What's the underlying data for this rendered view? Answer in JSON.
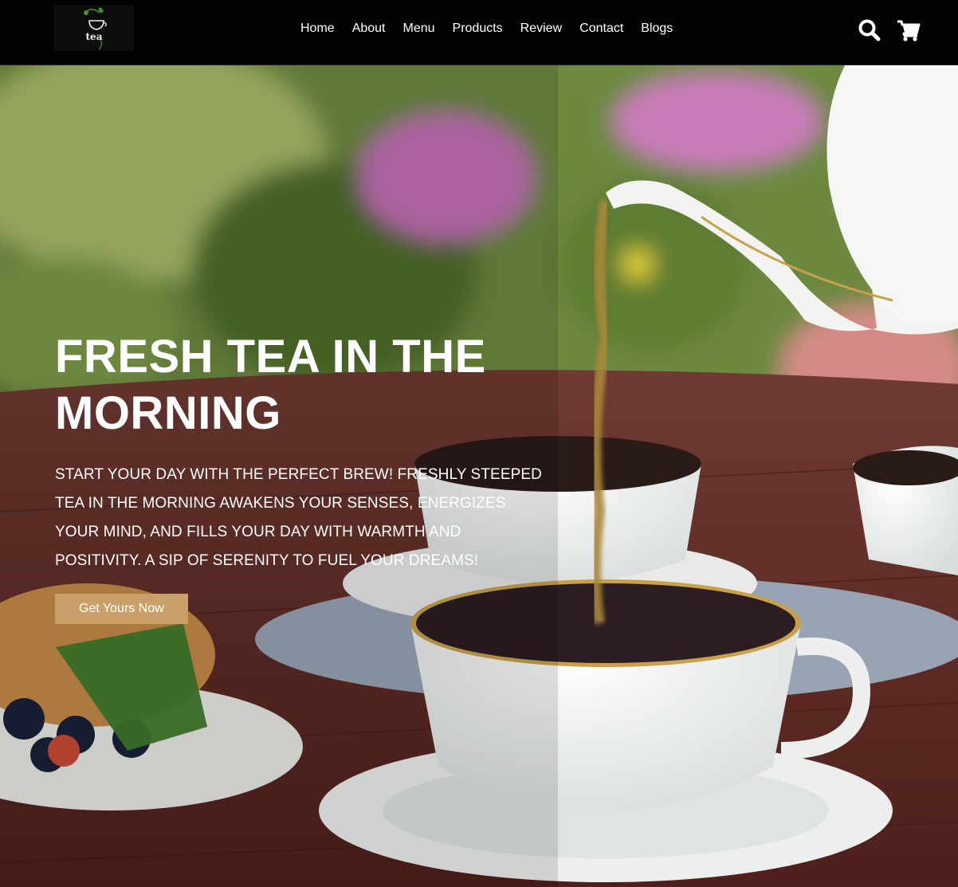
{
  "header": {
    "logo_text": "tea",
    "nav": [
      {
        "label": "Home"
      },
      {
        "label": "About"
      },
      {
        "label": "Menu"
      },
      {
        "label": "Products"
      },
      {
        "label": "Review"
      },
      {
        "label": "Contact"
      },
      {
        "label": "Blogs"
      }
    ],
    "icons": {
      "search": "search-icon",
      "cart": "shopping-cart-icon"
    }
  },
  "hero": {
    "title_line1": "FRESH TEA IN THE",
    "title_line2": "MORNING",
    "text": "START YOUR DAY WITH THE PERFECT BREW! FRESHLY STEEPED TEA IN THE MORNING AWAKENS YOUR SENSES, ENERGIZES YOUR MIND, AND FILLS YOUR DAY WITH WARMTH AND POSITIVITY. A SIP OF SERENITY TO FUEL YOUR DREAMS!",
    "cta_label": "Get Yours Now",
    "background_image": "teapot-pouring-tea-into-cups-photo"
  },
  "colors": {
    "header_bg": "#030303",
    "cta_bg": "#c9a06a",
    "text": "#ffffff"
  }
}
